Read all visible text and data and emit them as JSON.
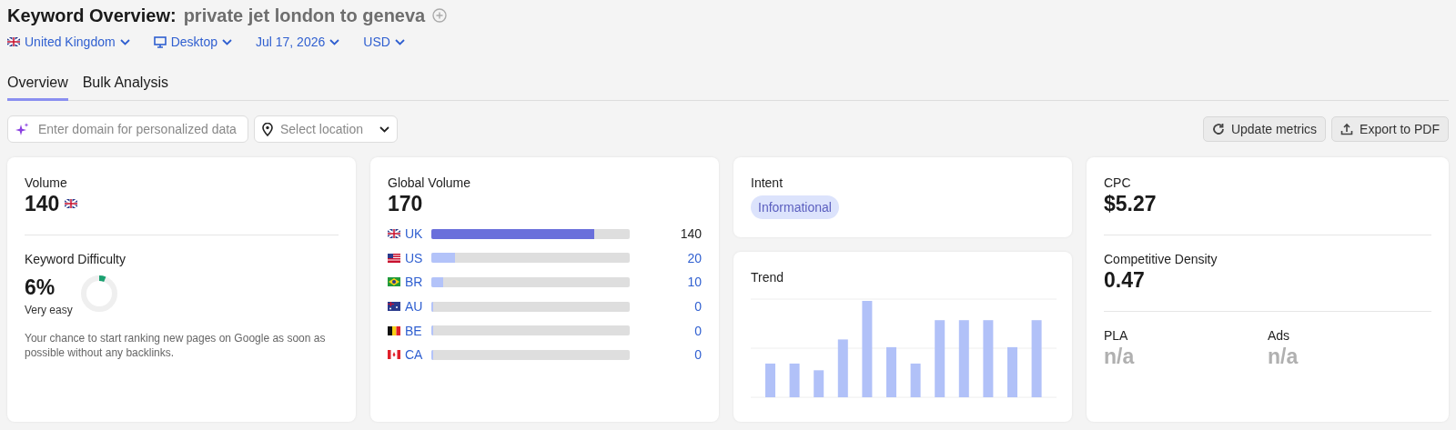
{
  "header": {
    "title": "Keyword Overview:",
    "keyword": "private jet london to geneva"
  },
  "filters": [
    {
      "kind": "gb",
      "label": "United Kingdom"
    },
    {
      "kind": "device",
      "label": "Desktop"
    },
    {
      "kind": "plain",
      "label": "Jul 17, 2026"
    },
    {
      "kind": "plain",
      "label": "USD"
    }
  ],
  "tabs": [
    {
      "label": "Overview",
      "selected": true
    },
    {
      "label": "Bulk Analysis",
      "selected": false
    }
  ],
  "toolbar": {
    "domain_placeholder": "Enter domain for personalized data",
    "location_placeholder": "Select location",
    "buttons": [
      {
        "kind": "refresh",
        "label": "Update metrics"
      },
      {
        "kind": "export",
        "label": "Export to PDF"
      }
    ]
  },
  "volume": {
    "label": "Volume",
    "value": "140",
    "kind": "gb"
  },
  "difficulty": {
    "label": "Keyword Difficulty",
    "value": "6%",
    "rating": "Very easy",
    "description": "Your chance to start ranking new pages on Google as soon as possible without any backlinks."
  },
  "global_volume": {
    "label": "Global Volume",
    "value": "170",
    "countries": [
      {
        "code": "UK",
        "kind": "gb",
        "level": 0.82,
        "value": "140",
        "highlighted": true
      },
      {
        "code": "US",
        "kind": "us",
        "level": 0.12,
        "value": "20",
        "highlighted": false
      },
      {
        "code": "BR",
        "kind": "br",
        "level": 0.06,
        "value": "10",
        "highlighted": false
      },
      {
        "code": "AU",
        "kind": "au",
        "level": 0.01,
        "value": "0",
        "highlighted": false
      },
      {
        "code": "BE",
        "kind": "be",
        "level": 0.01,
        "value": "0",
        "highlighted": false
      },
      {
        "code": "CA",
        "kind": "ca",
        "level": 0.01,
        "value": "0",
        "highlighted": false
      }
    ]
  },
  "intent": {
    "label": "Intent",
    "badge": "Informational"
  },
  "trend": {
    "label": "Trend"
  },
  "cpc": {
    "label": "CPC",
    "value": "$5.27"
  },
  "density": {
    "label": "Competitive Density",
    "value": "0.47"
  },
  "pla": {
    "label": "PLA",
    "value": "n/a"
  },
  "ads": {
    "label": "Ads",
    "value": "n/a"
  }
}
